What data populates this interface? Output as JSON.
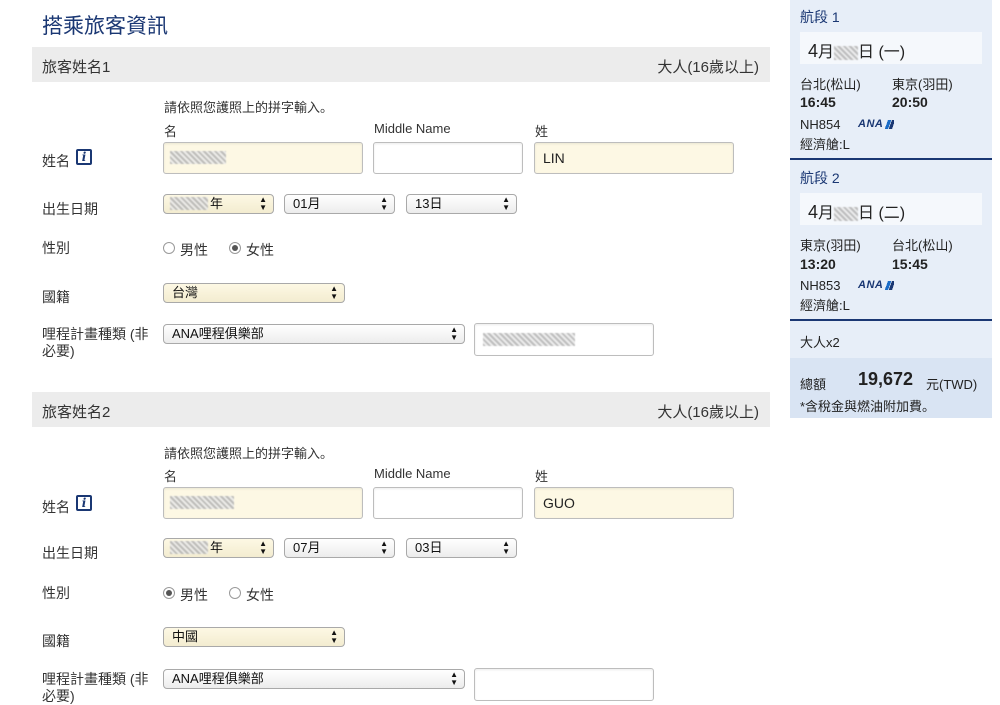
{
  "page_title": "搭乘旅客資訊",
  "passengers": [
    {
      "header_label": "旅客姓名1",
      "age_category": "大人(16歲以上)",
      "name_note": "請依照您護照上的拼字輸入。",
      "first_name_label": "名",
      "middle_name_label": "Middle Name",
      "last_name_label": "姓",
      "name_label": "姓名",
      "first_name_value": "",
      "middle_name_value": "",
      "last_name_value": "LIN",
      "dob_label": "出生日期",
      "dob_year": "年",
      "dob_month": "01月",
      "dob_day": "13日",
      "gender_label": "性別",
      "gender_male": "男性",
      "gender_female": "女性",
      "gender_selected": "female",
      "nationality_label": "國籍",
      "nationality_value": "台灣",
      "mileage_label_1": "哩程計畫種類 (非",
      "mileage_label_2": "必要)",
      "mileage_program": "ANA哩程俱樂部",
      "mileage_number": ""
    },
    {
      "header_label": "旅客姓名2",
      "age_category": "大人(16歲以上)",
      "name_note": "請依照您護照上的拼字輸入。",
      "first_name_label": "名",
      "middle_name_label": "Middle Name",
      "last_name_label": "姓",
      "name_label": "姓名",
      "first_name_value": "",
      "middle_name_value": "",
      "last_name_value": "GUO",
      "dob_label": "出生日期",
      "dob_year": "年",
      "dob_month": "07月",
      "dob_day": "03日",
      "gender_label": "性別",
      "gender_male": "男性",
      "gender_female": "女性",
      "gender_selected": "male",
      "nationality_label": "國籍",
      "nationality_value": "中國",
      "mileage_label_1": "哩程計畫種類 (非",
      "mileage_label_2": "必要)",
      "mileage_program": "ANA哩程俱樂部",
      "mileage_number": ""
    }
  ],
  "icons": {
    "info": "i",
    "select_arrow_up": "▲",
    "select_arrow_down": "▼"
  },
  "itinerary": {
    "segments": [
      {
        "title": "航段 1",
        "month": "4",
        "month_unit": "月",
        "day_suffix": "日 (一)",
        "from_city": "台北(松山)",
        "to_city": "東京(羽田)",
        "depart_time": "16:45",
        "arrive_time": "20:50",
        "flight_number": "NH854",
        "airline_logo_text": "ANA",
        "cabin": "經濟艙:L"
      },
      {
        "title": "航段 2",
        "month": "4",
        "month_unit": "月",
        "day_suffix": "日 (二)",
        "from_city": "東京(羽田)",
        "to_city": "台北(松山)",
        "depart_time": "13:20",
        "arrive_time": "15:45",
        "flight_number": "NH853",
        "airline_logo_text": "ANA",
        "cabin": "經濟艙:L"
      }
    ],
    "passenger_count": "大人x2",
    "total_label": "總額",
    "total_amount": "19,672",
    "currency": "元(TWD)",
    "tax_note": "*含稅金與燃油附加費。"
  },
  "colors": {
    "brand_navy": "#1a3773",
    "sidebar_bg": "#e7eef8",
    "header_bg": "#ececec",
    "filled_field_bg": "#fdf8e4"
  }
}
